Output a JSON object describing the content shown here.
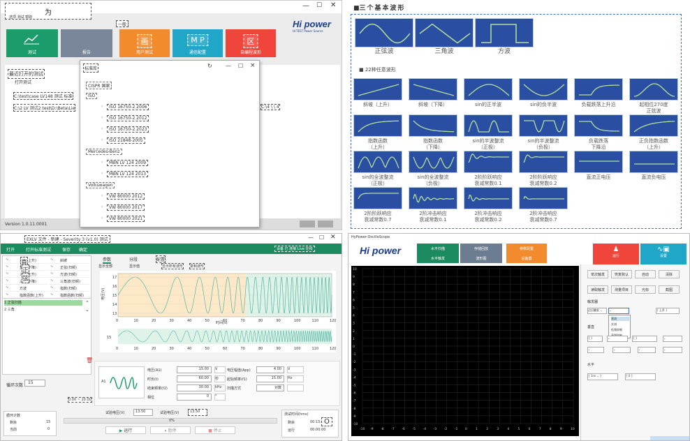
{
  "q1": {
    "title": "为",
    "menu": "选项 测试 帮助",
    "logo": "Hi power",
    "logo_sub": "Hi-TEST Power Source",
    "sub_label": "一般",
    "tiles": [
      {
        "label": "测试",
        "icon": ""
      },
      {
        "label": "报告",
        "icon": ""
      },
      {
        "label": "用户测试",
        "icon": "画"
      },
      {
        "label": "通信配置",
        "icon": "M P"
      },
      {
        "label": "自编程波形",
        "icon": "区"
      }
    ],
    "recent_title": "最近打开的测试",
    "open_label": "打开测试",
    "line1": "C:\\test\\case  LV148 测试 标准",
    "line2": "C:\\2 LV  测试2   test\\D:\\Beta\\Lie",
    "line3": "C:\\4 \\  \\ 4",
    "version": "Version 1.0.11.0001",
    "dialog": {
      "title": "标准库",
      "close": "×",
      "tree": [
        {
          "t": "CISPR 国家",
          "lvl": 0
        },
        {
          "t": "ISO",
          "lvl": 0
        },
        {
          "t": "ISO 16750-2 2006",
          "lvl": 1
        },
        {
          "t": "ISO 16750-2 2012",
          "lvl": 1
        },
        {
          "t": "ISO 16750-2 2023",
          "lvl": 1
        },
        {
          "t": "ISO 21848-2005",
          "lvl": 1
        },
        {
          "t": "Mercedes-Benz",
          "lvl": 0
        },
        {
          "t": "MBN LV 124 2009",
          "lvl": 1
        },
        {
          "t": "MBN LV 124 2013",
          "lvl": 1
        },
        {
          "t": "Volkswagen",
          "lvl": 0
        },
        {
          "t": "VW 80000 2012",
          "lvl": 1
        },
        {
          "t": "VW 80000 2017",
          "lvl": 1
        },
        {
          "t": "VW 80000 2021",
          "lvl": 1
        }
      ]
    }
  },
  "q2": {
    "title": "三个基本波形",
    "basic": [
      "正弦波",
      "三角波",
      "方波"
    ],
    "arb_title": "22种任意波形",
    "arb": [
      "斜坡（上升）",
      "斜坡（下降）",
      "sin的正半波",
      "sin的负半波",
      "负载跌落上升沿",
      "起相位270度\n正弦波",
      "指数函数\n（上升）",
      "指数函数\n（下降）",
      "sin的半波整流\n（正极）",
      "sin的半波整流\n（负极）",
      "负载跌落\n下降沿",
      "正负指数函数\n（上升）",
      "sin的全波整流\n（正极）",
      "sin的全波整流\n（负极）",
      "2阶阶跃响应\n衰减常数0.1",
      "2阶阶跃响应\n衰减常数0.2",
      "直流正电压",
      "直流负电压",
      "2阶阶跃响应\n衰减常数0.7",
      "2阶冲击响应\n衰减常数0.1",
      "2阶冲击响应\n衰减常数0.2",
      "2阶冲击响应\n衰减常数0.7"
    ]
  },
  "q3": {
    "title": "EXLV 文件 - 新建 - Severity 3 (v1.0) 测试",
    "toolbar": [
      "打开",
      "打开标准测试",
      "保存",
      "确定"
    ],
    "status": "设备 已 连接 Live 在线",
    "left_list": [
      "正弦(上升)",
      "正弦(下降)",
      "三角(上升)",
      "三角(下降)",
      "方波",
      "指数函数(上升)"
    ],
    "right_list": [
      "斜坡",
      "正弦(扫频)",
      "方波(扫频)",
      "三角波(扫频)",
      "指数(扫频)",
      "指数函数(扫频)"
    ],
    "mini_labels": [
      "直",
      "正",
      "弦"
    ],
    "steps": [
      "1 正弦扫描",
      "2 三角"
    ],
    "loop_label": "循环次数",
    "loop_val": "15",
    "tabs": [
      "参数",
      "分段",
      "配置"
    ],
    "view_btns": [
      "显示全部",
      "显示值",
      "显示所有波形",
      "复制波形"
    ],
    "chart_y_label": "电压(V)",
    "chart_x_label": "时间(s)",
    "params": [
      {
        "l": "电压(A1)",
        "v": "15.00",
        "u": "V"
      },
      {
        "l": "时长(t)",
        "v": "60.00",
        "u": "秒"
      },
      {
        "l": "结束频率(f2)",
        "v": "30.00",
        "u": "kHz"
      },
      {
        "l": "相位",
        "v": "0",
        "u": "°"
      }
    ],
    "params2": [
      {
        "l": "电压幅值(App)",
        "v": "4.00",
        "u": "V"
      },
      {
        "l": "起始频率(f1)",
        "v": "15.00",
        "u": "Hz"
      },
      {
        "l": "扫描方式",
        "v": "对数",
        "u": ""
      }
    ],
    "wave_box_label": "A1",
    "vmin_label": "试验电压(V)",
    "vmin": "13.50",
    "vmax_label": "试验电压(V)",
    "vmax": "13.50",
    "test_time_label": "测试时间(hms)",
    "cnt_title": "循环计数",
    "cnt_rows": [
      {
        "l": "剩余",
        "v": "15"
      },
      {
        "l": "当前",
        "v": "0"
      }
    ],
    "tt_rows": [
      {
        "l": "剩余",
        "v": "00:15:00"
      },
      {
        "l": "运行",
        "v": "00:00:00"
      }
    ],
    "progress": "0%",
    "run": "运行",
    "pause": "暂停",
    "stop": "停止",
    "small_tag": "0.00 ~ 10.00",
    "warn": "O"
  },
  "q4": {
    "title": "HyPower-OscilloScope",
    "logo": "Hi power",
    "tiles": [
      {
        "label": "水平扫描"
      },
      {
        "label": "水平触发"
      },
      {
        "label": "存储回放"
      },
      {
        "label": "波形图"
      },
      {
        "label": "参数配置"
      },
      {
        "label": "设备器"
      }
    ],
    "run_label": "运行",
    "set_label": "设置",
    "btns": [
      "单次触发",
      "恢复默认",
      "自动",
      "清除",
      "读取触发",
      "测量项目",
      "光标",
      "截图"
    ],
    "trigger_title": "触发器",
    "dropdown_items": [
      "直流",
      "交流",
      "低频抑制",
      "高频抑制"
    ],
    "trig_mode": "边沿触发",
    "trig_val": "上升",
    "vert_title": "垂直",
    "horiz_title": "水平",
    "horiz_vals": [
      "1ns",
      "0"
    ],
    "x_ticks": [
      "-10",
      "-9",
      "-8",
      "-7",
      "-6",
      "-5",
      "-4",
      "-3",
      "-2",
      "-1",
      "0",
      "1",
      "2",
      "3",
      "4",
      "5",
      "6",
      "7",
      "8",
      "9",
      "10"
    ],
    "y_ticks": [
      "10",
      "9",
      "8",
      "7",
      "6",
      "5",
      "4",
      "3",
      "2",
      "1",
      "0",
      "-1",
      "-2",
      "-3",
      "-4",
      "-5",
      "-6",
      "-7",
      "-8",
      "-9",
      "-10"
    ]
  }
}
